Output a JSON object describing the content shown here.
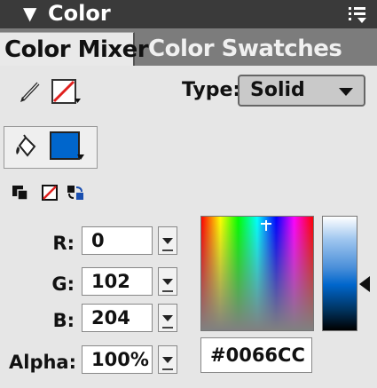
{
  "panel": {
    "title": "Color",
    "colors": {
      "titlebar": "#3a3a3a",
      "fill": "#0066cc",
      "stroke_none": "#e0201e"
    }
  },
  "tabs": [
    {
      "label": "Color Mixer",
      "active": true
    },
    {
      "label": "Color Swatches",
      "active": false
    }
  ],
  "icons": {
    "collapse": "triangle-down-icon",
    "menu": "panel-menu-icon",
    "stroke": "pencil-icon",
    "fill": "paint-bucket-icon",
    "default_colors": "black-white-icon",
    "no_color": "no-color-icon",
    "swap": "swap-colors-icon"
  },
  "type": {
    "label": "Type:",
    "value": "Solid"
  },
  "rgb": {
    "r": {
      "label": "R:",
      "value": "0"
    },
    "g": {
      "label": "G:",
      "value": "102"
    },
    "b": {
      "label": "B:",
      "value": "204"
    },
    "alpha": {
      "label": "Alpha:",
      "value": "100%"
    }
  },
  "hex": "#0066CC"
}
